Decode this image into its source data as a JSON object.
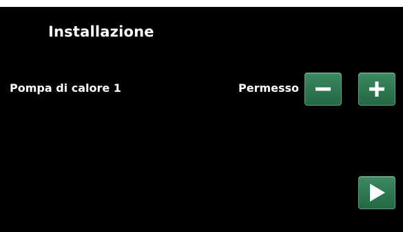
{
  "header": {
    "title": "Installazione"
  },
  "setting": {
    "label": "Pompa di calore 1",
    "value": "Permesso"
  },
  "controls": {
    "decrease_icon": "minus-icon",
    "increase_icon": "plus-icon",
    "next_icon": "play-arrow-icon"
  },
  "colors": {
    "background": "#000000",
    "text": "#ffffff",
    "button_green": "#2f7a53"
  }
}
